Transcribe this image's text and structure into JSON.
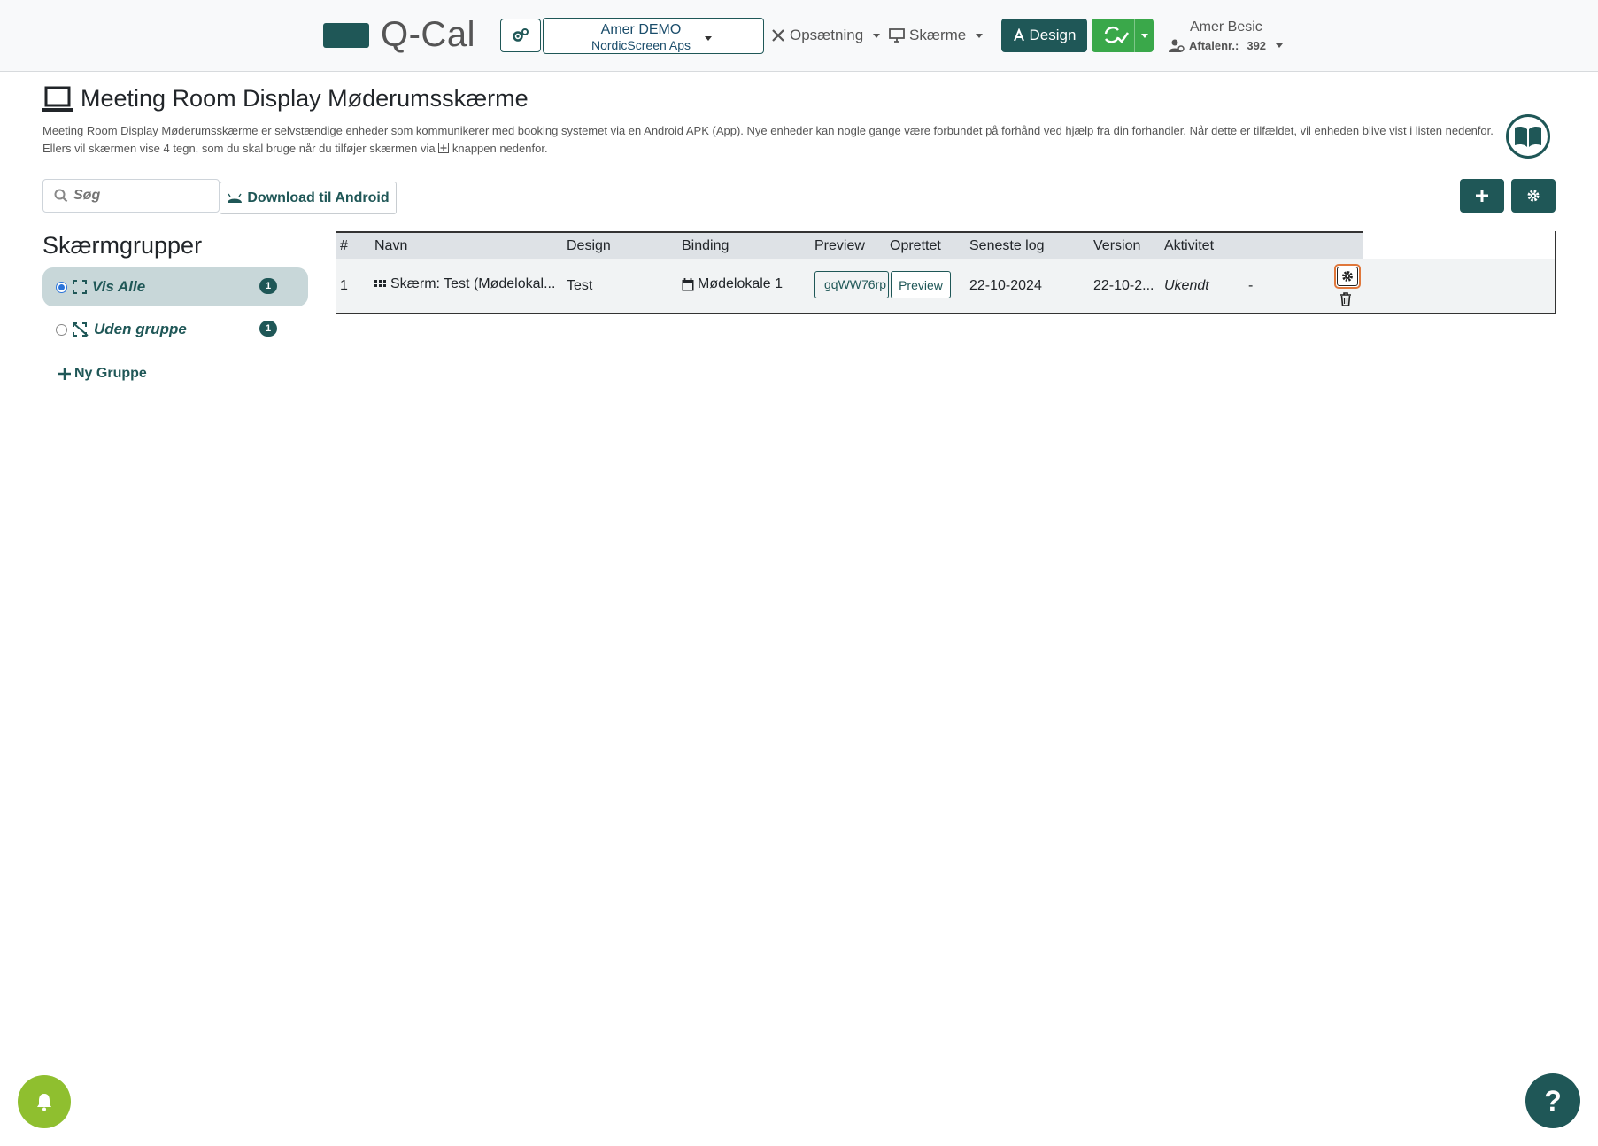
{
  "app": {
    "logo_text": "Q-Cal",
    "brand_color": "#1f5757",
    "accent_green": "#3aa84a"
  },
  "topbar": {
    "account": {
      "name": "Amer DEMO",
      "company": "NordicScreen Aps"
    },
    "nav": [
      {
        "label": "Opsætning",
        "icon": "tools-icon"
      },
      {
        "label": "Skærme",
        "icon": "monitor-icon"
      }
    ],
    "design_label": "Design",
    "user": {
      "name": "Amer Besic",
      "aftalenr_label": "Aftalenr.:",
      "aftalenr_value": "392"
    }
  },
  "page": {
    "title": "Meeting Room Display Møderumsskærme",
    "description_1": "Meeting Room Display Møderumsskærme er selvstændige enheder som kommunikerer med booking systemet via en Android APK (App). Nye enheder kan nogle gange være forbundet på forhånd ved hjælp fra din forhandler. Når dette er tilfældet, vil enheden blive vist i listen nedenfor. Ellers vil skærmen vise 4 tegn, som du skal bruge når du tilføjer skærmen via",
    "description_2": "knappen nedenfor."
  },
  "search": {
    "placeholder": "Søg",
    "value": ""
  },
  "download_label": "Download til Android",
  "sidebar": {
    "title": "Skærmgrupper",
    "groups": [
      {
        "label": "Vis Alle",
        "count": "1",
        "selected": true
      },
      {
        "label": "Uden gruppe",
        "count": "1",
        "selected": false
      }
    ],
    "new_group_label": "Ny Gruppe"
  },
  "table": {
    "headers": [
      "#",
      "Navn",
      "Design",
      "Binding",
      "Preview",
      "Oprettet",
      "Seneste log",
      "Version",
      "Aktivitet"
    ],
    "rows": [
      {
        "num": "1",
        "name": "Skærm: Test (Mødelokal...",
        "design": "Test",
        "binding": "Mødelokale 1",
        "preview_code": "gqWW76rp",
        "preview_button": "Preview",
        "created": "22-10-2024",
        "last_log": "22-10-2...",
        "version": "Ukendt",
        "activity": "-"
      }
    ]
  },
  "help_label": "?"
}
